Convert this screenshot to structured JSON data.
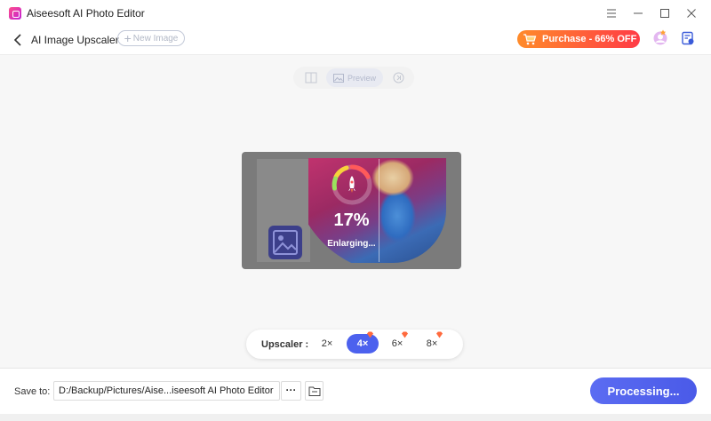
{
  "window": {
    "title": "Aiseesoft AI Photo Editor"
  },
  "header": {
    "page_title": "AI Image Upscaler",
    "new_image_label": "New Image",
    "purchase_label": "Purchase - 66% OFF"
  },
  "view": {
    "preview_label": "Preview"
  },
  "progress": {
    "percent_text": "17%",
    "percent_value": 17,
    "status": "Enlarging..."
  },
  "upscaler": {
    "label": "Upscaler :",
    "options": [
      "2×",
      "4×",
      "6×",
      "8×"
    ],
    "selected": "4×"
  },
  "footer": {
    "save_label": "Save to:",
    "save_path": "D:/Backup/Pictures/Aise...iseesoft AI Photo Editor",
    "more_label": "···",
    "processing_label": "Processing..."
  },
  "colors": {
    "accent": "#4c61ee",
    "purchase_start": "#ff8b2a",
    "purchase_end": "#ff3b46",
    "canvas_bg": "#f7f7f7"
  },
  "icons": {
    "app": "app-logo-icon",
    "back": "chevron-left-icon",
    "cart": "cart-icon",
    "avatar": "user-avatar-icon",
    "docs": "document-icon",
    "compare": "split-view-icon",
    "preview": "image-icon",
    "skip": "skip-forward-icon",
    "rocket": "rocket-icon",
    "gem": "gem-icon",
    "folder": "folder-icon"
  }
}
